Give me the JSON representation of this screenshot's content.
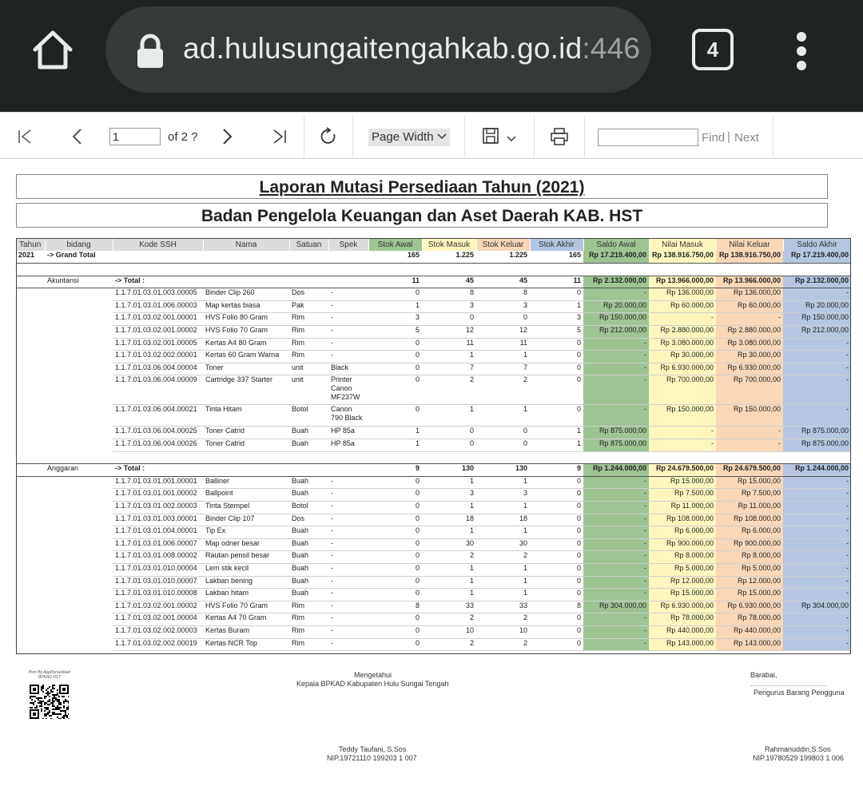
{
  "browser": {
    "url_host": "ad.hulusungaitengahkab.go.id",
    "url_port": ":446",
    "tab_count": "4"
  },
  "toolbar": {
    "page_current": "1",
    "page_of": "of 2 ?",
    "zoom": "Page Width",
    "find_label": "Find",
    "find_separator": "|",
    "next_label": "Next"
  },
  "report": {
    "title": "Laporan Mutasi Persediaan Tahun (2021)",
    "subtitle": "Badan Pengelola Keuangan dan Aset Daerah KAB. HST",
    "headers": [
      "Tahun",
      "bidang",
      "Kode SSH",
      "Nama",
      "Satuan",
      "Spek",
      "Stok Awal",
      "Stok Masuk",
      "Stok Keluar",
      "Stok Akhir",
      "Saldo Awal",
      "Nilai Masuk",
      "Nilai Keluar",
      "Saldo Akhir"
    ],
    "header_colors": [
      "#dcdcdc",
      "#dcdcdc",
      "#dcdcdc",
      "#dcdcdc",
      "#dcdcdc",
      "#dcdcdc",
      "#9dc592",
      "#fff6bf",
      "#f9d7b7",
      "#b4c6e2",
      "#9dc592",
      "#fff6bf",
      "#f9d7b7",
      "#b4c6e2"
    ],
    "grand_total": {
      "tahun": "2021",
      "label": "-> Grand Total",
      "stok_awal": "165",
      "stok_masuk": "1.225",
      "stok_keluar": "1.225",
      "stok_akhir": "165",
      "saldo_awal": "Rp 17.219.400,00",
      "nilai_masuk": "Rp 138.916.750,00",
      "nilai_keluar": "Rp 138.916.750,00",
      "saldo_akhir": "Rp 17.219.400,00"
    },
    "groups": [
      {
        "bidang": "Akuntansi",
        "total_label": "-> Total :",
        "stok_awal": "11",
        "stok_masuk": "45",
        "stok_keluar": "45",
        "stok_akhir": "11",
        "saldo_awal": "Rp 2.132.000,00",
        "nilai_masuk": "Rp 13.966.000,00",
        "nilai_keluar": "Rp 13.966.000,00",
        "saldo_akhir": "Rp 2.132.000,00",
        "rows": [
          {
            "kode": "1.1.7.01.03.01.003.00005",
            "nama": "Binder Clip 260",
            "satuan": "Dos",
            "spek": "-",
            "sa": "0",
            "sm": "8",
            "sk": "8",
            "sak": "0",
            "saldo_awal": "-",
            "nilai_masuk": "Rp 136.000,00",
            "nilai_keluar": "Rp 136.000,00",
            "saldo_akhir": "-"
          },
          {
            "kode": "1.1.7.01.03.01.006.00003",
            "nama": "Map kertas biasa",
            "satuan": "Pak",
            "spek": "-",
            "sa": "1",
            "sm": "3",
            "sk": "3",
            "sak": "1",
            "saldo_awal": "Rp 20.000,00",
            "nilai_masuk": "Rp 60.000,00",
            "nilai_keluar": "Rp 60.000,00",
            "saldo_akhir": "Rp 20.000,00"
          },
          {
            "kode": "1.1.7.01.03.02.001.00001",
            "nama": "HVS Folio 80 Gram",
            "satuan": "Rim",
            "spek": "-",
            "sa": "3",
            "sm": "0",
            "sk": "0",
            "sak": "3",
            "saldo_awal": "Rp 150.000,00",
            "nilai_masuk": "-",
            "nilai_keluar": "-",
            "saldo_akhir": "Rp 150.000,00"
          },
          {
            "kode": "1.1.7.01.03.02.001.00002",
            "nama": "HVS Folio 70 Gram",
            "satuan": "Rim",
            "spek": "-",
            "sa": "5",
            "sm": "12",
            "sk": "12",
            "sak": "5",
            "saldo_awal": "Rp 212.000,00",
            "nilai_masuk": "Rp 2.880.000,00",
            "nilai_keluar": "Rp 2.880.000,00",
            "saldo_akhir": "Rp 212.000,00"
          },
          {
            "kode": "1.1.7.01.03.02.001.00005",
            "nama": "Kertas A4 80 Gram",
            "satuan": "Rim",
            "spek": "-",
            "sa": "0",
            "sm": "11",
            "sk": "11",
            "sak": "0",
            "saldo_awal": "-",
            "nilai_masuk": "Rp 3.080.000,00",
            "nilai_keluar": "Rp 3.080.000,00",
            "saldo_akhir": "-"
          },
          {
            "kode": "1.1.7.01.03.02.002.00001",
            "nama": "Kertas 60 Gram Warna",
            "satuan": "Rim",
            "spek": "-",
            "sa": "0",
            "sm": "1",
            "sk": "1",
            "sak": "0",
            "saldo_awal": "-",
            "nilai_masuk": "Rp 30.000,00",
            "nilai_keluar": "Rp 30.000,00",
            "saldo_akhir": "-"
          },
          {
            "kode": "1.1.7.01.03.06.004.00004",
            "nama": "Toner",
            "satuan": "unit",
            "spek": "Black",
            "sa": "0",
            "sm": "7",
            "sk": "7",
            "sak": "0",
            "saldo_awal": "-",
            "nilai_masuk": "Rp 6.930.000,00",
            "nilai_keluar": "Rp 6.930.000,00",
            "saldo_akhir": "-"
          },
          {
            "kode": "1.1.7.01.03.06.004.00009",
            "nama": "Cartridge 337 Starter",
            "satuan": "unit",
            "spek": "Printer Canon MF237W",
            "sa": "0",
            "sm": "2",
            "sk": "2",
            "sak": "0",
            "saldo_awal": "-",
            "nilai_masuk": "Rp 700.000,00",
            "nilai_keluar": "Rp 700.000,00",
            "saldo_akhir": "-",
            "tall": "tall3"
          },
          {
            "kode": "1.1.7.01.03.06.004.00021",
            "nama": "Tinta Hitam",
            "satuan": "Botol",
            "spek": "Canon 790 Black",
            "sa": "0",
            "sm": "1",
            "sk": "1",
            "sak": "0",
            "saldo_awal": "-",
            "nilai_masuk": "Rp 150.000,00",
            "nilai_keluar": "Rp 150.000,00",
            "saldo_akhir": "-",
            "tall": "tall2"
          },
          {
            "kode": "1.1.7.01.03.06.004.00025",
            "nama": "Toner Catrid",
            "satuan": "Buah",
            "spek": "HP 85a",
            "sa": "1",
            "sm": "0",
            "sk": "0",
            "sak": "1",
            "saldo_awal": "Rp 875.000,00",
            "nilai_masuk": "-",
            "nilai_keluar": "-",
            "saldo_akhir": "Rp 875.000,00"
          },
          {
            "kode": "1.1.7.01.03.06.004.00026",
            "nama": "Toner Catrid",
            "satuan": "Buah",
            "spek": "HP 85a",
            "sa": "1",
            "sm": "0",
            "sk": "0",
            "sak": "1",
            "saldo_awal": "Rp 875.000,00",
            "nilai_masuk": "-",
            "nilai_keluar": "-",
            "saldo_akhir": "Rp 875.000,00"
          }
        ]
      },
      {
        "bidang": "Anggaran",
        "total_label": "-> Total :",
        "stok_awal": "9",
        "stok_masuk": "130",
        "stok_keluar": "130",
        "stok_akhir": "9",
        "saldo_awal": "Rp 1.244.000,00",
        "nilai_masuk": "Rp 24.679.500,00",
        "nilai_keluar": "Rp 24.679.500,00",
        "saldo_akhir": "Rp 1.244.000,00",
        "rows": [
          {
            "kode": "1.1.7.01.03.01.001.00001",
            "nama": "Balliner",
            "satuan": "Buah",
            "spek": "-",
            "sa": "0",
            "sm": "1",
            "sk": "1",
            "sak": "0",
            "saldo_awal": "-",
            "nilai_masuk": "Rp 15.000,00",
            "nilai_keluar": "Rp 15.000,00",
            "saldo_akhir": "-"
          },
          {
            "kode": "1.1.7.01.03.01.001.00002",
            "nama": "Ballpoint",
            "satuan": "Buah",
            "spek": "-",
            "sa": "0",
            "sm": "3",
            "sk": "3",
            "sak": "0",
            "saldo_awal": "-",
            "nilai_masuk": "Rp 7.500,00",
            "nilai_keluar": "Rp 7.500,00",
            "saldo_akhir": "-"
          },
          {
            "kode": "1.1.7.01.03.01.002.00003",
            "nama": "Tinta Stempel",
            "satuan": "Botol",
            "spek": "-",
            "sa": "0",
            "sm": "1",
            "sk": "1",
            "sak": "0",
            "saldo_awal": "-",
            "nilai_masuk": "Rp 11.000,00",
            "nilai_keluar": "Rp 11.000,00",
            "saldo_akhir": "-"
          },
          {
            "kode": "1.1.7.01.03.01.003.00001",
            "nama": "Binder Clip 107",
            "satuan": "Dos",
            "spek": "-",
            "sa": "0",
            "sm": "18",
            "sk": "18",
            "sak": "0",
            "saldo_awal": "-",
            "nilai_masuk": "Rp 108.000,00",
            "nilai_keluar": "Rp 108.000,00",
            "saldo_akhir": "-"
          },
          {
            "kode": "1.1.7.01.03.01.004.00001",
            "nama": "Tip Ex",
            "satuan": "Buah",
            "spek": "-",
            "sa": "0",
            "sm": "1",
            "sk": "1",
            "sak": "0",
            "saldo_awal": "-",
            "nilai_masuk": "Rp 6.000,00",
            "nilai_keluar": "Rp 6.000,00",
            "saldo_akhir": "-"
          },
          {
            "kode": "1.1.7.01.03.01.006.00007",
            "nama": "Map odner besar",
            "satuan": "Buah",
            "spek": "-",
            "sa": "0",
            "sm": "30",
            "sk": "30",
            "sak": "0",
            "saldo_awal": "-",
            "nilai_masuk": "Rp 900.000,00",
            "nilai_keluar": "Rp 900.000,00",
            "saldo_akhir": "-"
          },
          {
            "kode": "1.1.7.01.03.01.008.00002",
            "nama": "Rautan pensil besar",
            "satuan": "Buah",
            "spek": "-",
            "sa": "0",
            "sm": "2",
            "sk": "2",
            "sak": "0",
            "saldo_awal": "-",
            "nilai_masuk": "Rp 8.000,00",
            "nilai_keluar": "Rp 8.000,00",
            "saldo_akhir": "-"
          },
          {
            "kode": "1.1.7.01.03.01.010.00004",
            "nama": "Lem stik kecil",
            "satuan": "Buah",
            "spek": "-",
            "sa": "0",
            "sm": "1",
            "sk": "1",
            "sak": "0",
            "saldo_awal": "-",
            "nilai_masuk": "Rp 5.000,00",
            "nilai_keluar": "Rp 5.000,00",
            "saldo_akhir": "-"
          },
          {
            "kode": "1.1.7.01.03.01.010.00007",
            "nama": "Lakban bening",
            "satuan": "Buah",
            "spek": "-",
            "sa": "0",
            "sm": "1",
            "sk": "1",
            "sak": "0",
            "saldo_awal": "-",
            "nilai_masuk": "Rp 12.000,00",
            "nilai_keluar": "Rp 12.000,00",
            "saldo_akhir": "-"
          },
          {
            "kode": "1.1.7.01.03.01.010.00008",
            "nama": "Lakban hitam",
            "satuan": "Buah",
            "spek": "-",
            "sa": "0",
            "sm": "1",
            "sk": "1",
            "sak": "0",
            "saldo_awal": "-",
            "nilai_masuk": "Rp 15.000,00",
            "nilai_keluar": "Rp 15.000,00",
            "saldo_akhir": "-"
          },
          {
            "kode": "1.1.7.01.03.02.001.00002",
            "nama": "HVS Folio 70 Gram",
            "satuan": "Rim",
            "spek": "-",
            "sa": "8",
            "sm": "33",
            "sk": "33",
            "sak": "8",
            "saldo_awal": "Rp 304.000,00",
            "nilai_masuk": "Rp 6.930.000,00",
            "nilai_keluar": "Rp 6.930.000,00",
            "saldo_akhir": "Rp 304.000,00"
          },
          {
            "kode": "1.1.7.01.03.02.001.00004",
            "nama": "Kertas A4 70 Gram",
            "satuan": "Rim",
            "spek": "-",
            "sa": "0",
            "sm": "2",
            "sk": "2",
            "sak": "0",
            "saldo_awal": "-",
            "nilai_masuk": "Rp 78.000,00",
            "nilai_keluar": "Rp 78.000,00",
            "saldo_akhir": "-"
          },
          {
            "kode": "1.1.7.01.03.02.002.00003",
            "nama": "Kertas Buram",
            "satuan": "Rim",
            "spek": "-",
            "sa": "0",
            "sm": "10",
            "sk": "10",
            "sak": "0",
            "saldo_awal": "-",
            "nilai_masuk": "Rp 440.000,00",
            "nilai_keluar": "Rp 440.000,00",
            "saldo_akhir": "-"
          },
          {
            "kode": "1.1.7.01.03.02.002.00019",
            "nama": "Kertas NCR Top",
            "satuan": "Rim",
            "spek": "-",
            "sa": "0",
            "sm": "2",
            "sk": "2",
            "sak": "0",
            "saldo_awal": "-",
            "nilai_masuk": "Rp 143.000,00",
            "nilai_keluar": "Rp 143.000,00",
            "saldo_akhir": "-"
          }
        ]
      }
    ]
  },
  "footer": {
    "print_by": "Print By AppPersediaan BPKAD HST",
    "mengetahui": "Mengetahui",
    "kepala": "Kepala BPKAD Kabupaten Hulu Sungai Tengah",
    "barabai": "Barabai,",
    "dots": "......................................",
    "pengurus": "Pengurus Barang Pengguna",
    "sign1_name": "Teddy Taufani, S.Sos",
    "sign1_nip": "NIP.19721110 199203 1 007",
    "sign2_name": "Rahmanuddin,S.Sos",
    "sign2_nip": "NIP.19780529 199803 1 006"
  }
}
